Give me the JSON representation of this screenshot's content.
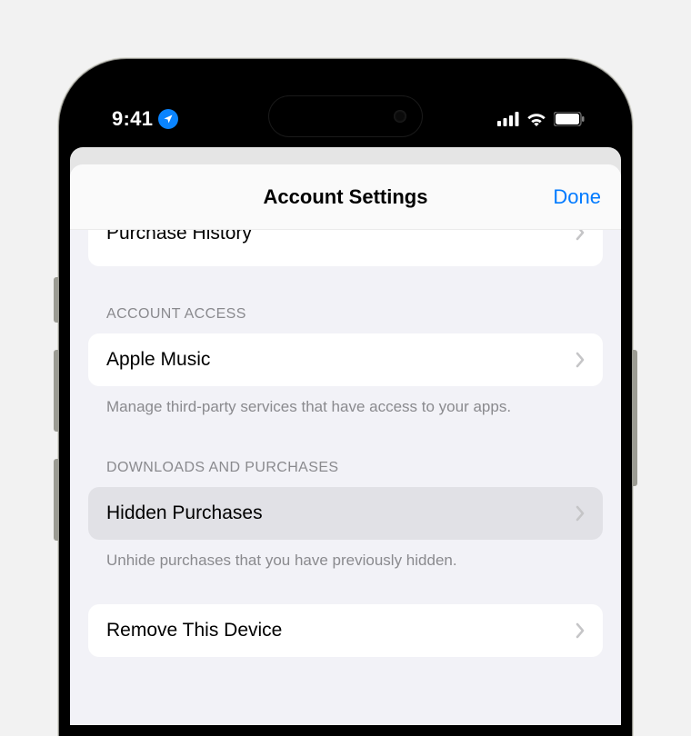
{
  "status": {
    "time": "9:41"
  },
  "sheet": {
    "title": "Account Settings",
    "done": "Done",
    "partial_row_label": "Purchase History"
  },
  "sections": {
    "account_access": {
      "header": "ACCOUNT ACCESS",
      "items": [
        {
          "label": "Apple Music"
        }
      ],
      "footer": "Manage third-party services that have access to your apps."
    },
    "downloads": {
      "header": "DOWNLOADS AND PURCHASES",
      "items": [
        {
          "label": "Hidden Purchases"
        }
      ],
      "footer": "Unhide purchases that you have previously hidden."
    },
    "remove": {
      "items": [
        {
          "label": "Remove This Device"
        }
      ]
    }
  }
}
